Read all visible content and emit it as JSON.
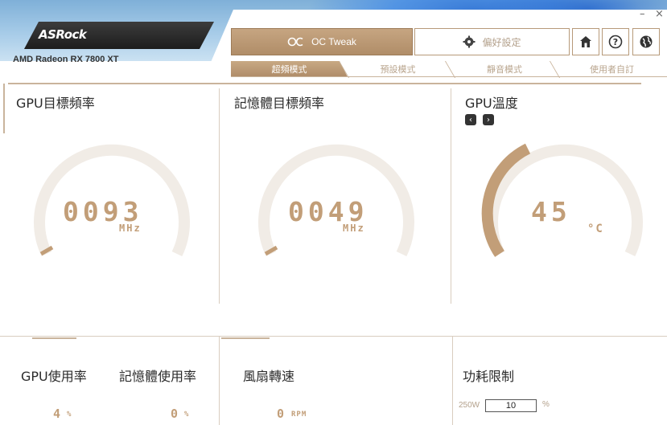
{
  "app": {
    "brand": "ASRock",
    "model": "AMD Radeon RX 7800 XT",
    "minimize": "–",
    "close": "×"
  },
  "nav": {
    "oc_tweak": "OC Tweak",
    "preferences": "偏好設定",
    "icons": [
      "home-icon",
      "help-icon",
      "globe-icon"
    ]
  },
  "modes": [
    {
      "label": "超頻模式",
      "active": true
    },
    {
      "label": "預設模式",
      "active": false
    },
    {
      "label": "靜音模式",
      "active": false
    },
    {
      "label": "使用者自訂",
      "active": false
    }
  ],
  "panels": {
    "gpu_clock": {
      "title": "GPU目標頻率",
      "value": "0093",
      "unit": "MHz"
    },
    "mem_clock": {
      "title": "記憶體目標頻率",
      "value": "0049",
      "unit": "MHz"
    },
    "gpu_temp": {
      "title": "GPU溫度",
      "value": "45",
      "unit": "°C",
      "prev": "‹",
      "next": "›"
    }
  },
  "bottom": {
    "gpu_usage": {
      "title": "GPU使用率",
      "value": "4",
      "unit": "%"
    },
    "mem_usage": {
      "title": "記憶體使用率",
      "value": "0",
      "unit": "%"
    },
    "fan_speed": {
      "title": "風扇轉速",
      "value": "0",
      "unit": "RPM"
    },
    "power_limit": {
      "title": "功耗限制",
      "prefix": "250W",
      "value": "10",
      "unit": "%"
    }
  },
  "colors": {
    "accent": "#c29e78",
    "accent_dark": "#b08d68",
    "track": "#f1ece6"
  }
}
